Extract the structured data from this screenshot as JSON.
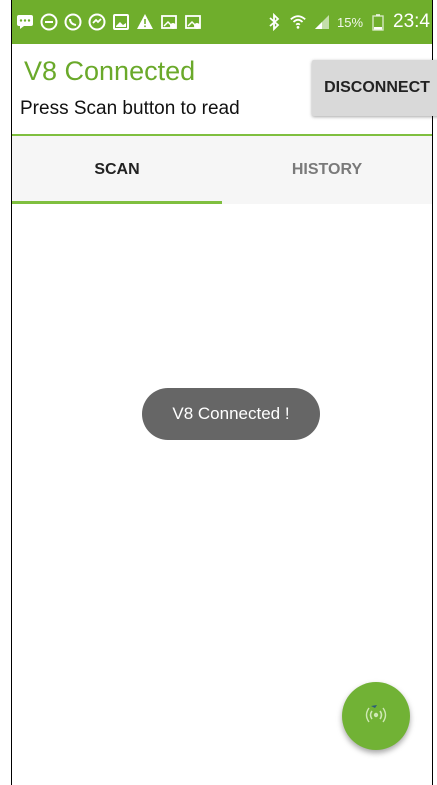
{
  "status_bar": {
    "battery_percent": "15%",
    "time": "23:4",
    "icons": [
      "message-icon",
      "minus-circle-icon",
      "whatsapp-icon",
      "messenger-icon",
      "gallery-icon",
      "warning-icon",
      "image-notif-icon",
      "image-notif-icon",
      "bluetooth-icon",
      "wifi-icon",
      "signal-icon",
      "battery-icon"
    ]
  },
  "header": {
    "title": "V8 Connected",
    "subtitle": "Press Scan button to read",
    "disconnect_label": "DISCONNECT"
  },
  "tabs": [
    {
      "label": "SCAN",
      "active": true
    },
    {
      "label": "HISTORY",
      "active": false
    }
  ],
  "toast": {
    "text": "V8 Connected !"
  },
  "fab": {
    "icon": "nfc-scan-icon"
  },
  "colors": {
    "accent": "#6fae2c",
    "title_green": "#6aa92a",
    "toast_bg": "#666666",
    "button_bg": "#d9d9d9"
  }
}
